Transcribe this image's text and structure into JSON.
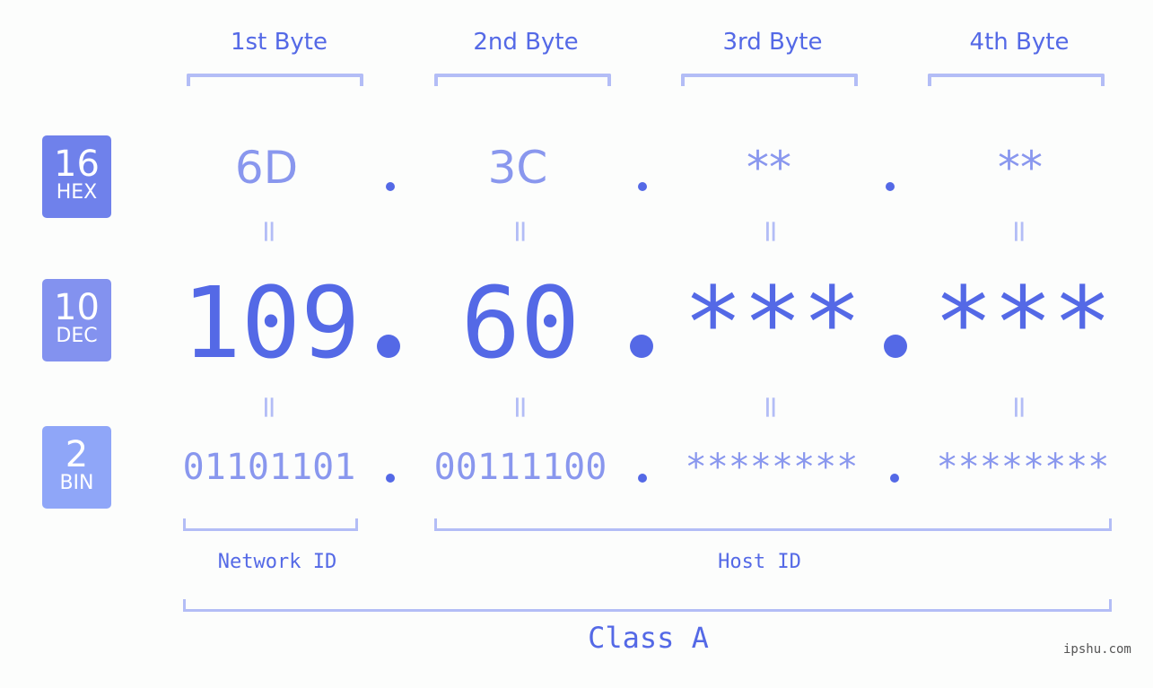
{
  "bytes": [
    {
      "label": "1st Byte",
      "hex": "6D",
      "dec": "109",
      "bin": "01101101"
    },
    {
      "label": "2nd Byte",
      "hex": "3C",
      "dec": "60",
      "bin": "00111100"
    },
    {
      "label": "3rd Byte",
      "hex": "**",
      "dec": "***",
      "bin": "********"
    },
    {
      "label": "4th Byte",
      "hex": "**",
      "dec": "***",
      "bin": "********"
    }
  ],
  "badges": {
    "hex": {
      "num": "16",
      "label": "HEX",
      "color": "#6f81eb"
    },
    "dec": {
      "num": "10",
      "label": "DEC",
      "color": "#8392ef"
    },
    "bin": {
      "num": "2",
      "label": "BIN",
      "color": "#8fa6f8"
    }
  },
  "equals_sign": "=",
  "network_id_label": "Network ID",
  "host_id_label": "Host ID",
  "class_label": "Class A",
  "watermark": "ipshu.com",
  "colors": {
    "primary": "#5469e6",
    "secondary": "#8997ee",
    "bracket": "#b3bdf6"
  }
}
